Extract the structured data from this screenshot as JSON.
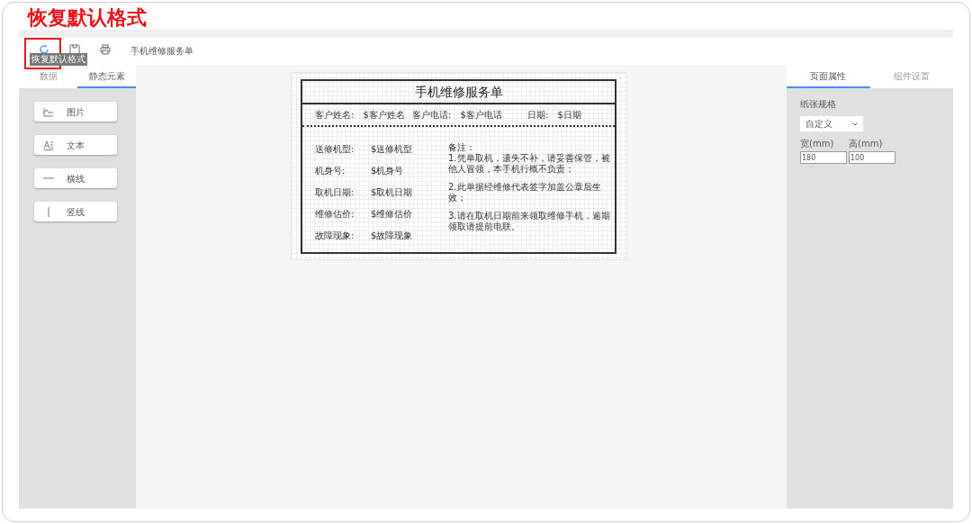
{
  "annotation": {
    "title": "恢复默认格式"
  },
  "toolbar": {
    "buttons": [
      {
        "kind": "reset"
      },
      {
        "kind": "save"
      },
      {
        "kind": "print"
      }
    ],
    "document_name": "手机维修服务单",
    "tooltip": "恢复默认格式"
  },
  "left_panel": {
    "tabs": [
      {
        "label": "数据",
        "selected": false
      },
      {
        "label": "静态元素",
        "selected": true
      }
    ],
    "items": [
      {
        "kind": "image",
        "label": "图片"
      },
      {
        "kind": "text",
        "label": "文本"
      },
      {
        "kind": "hline",
        "label": "横线"
      },
      {
        "kind": "vline",
        "label": "竖线"
      }
    ]
  },
  "form": {
    "title": "手机维修服务单",
    "header": [
      {
        "label": "客户姓名:",
        "value": "$客户姓名"
      },
      {
        "label": "客户电话:",
        "value": "$客户电话"
      },
      {
        "label": "日期:",
        "value": "$日期"
      }
    ],
    "fields": [
      {
        "label": "送修机型:",
        "value": "$送修机型"
      },
      {
        "label": "机身号:",
        "value": "$机身号"
      },
      {
        "label": "取机日期:",
        "value": "$取机日期"
      },
      {
        "label": "维修估价:",
        "value": "$维修估价"
      },
      {
        "label": "故障现象:",
        "value": "$故障现象"
      }
    ],
    "notes_title": "备注：",
    "notes": [
      "1.凭单取机，遗失不补，请妥善保管，被他人冒领，本手机行概不负责；",
      "2.此单据经维修代表签字加盖公章后生效；",
      "3.请在取机日期前来领取维修手机，逾期领取请提前电联。"
    ]
  },
  "right_panel": {
    "tabs": [
      {
        "label": "页面属性",
        "selected": true
      },
      {
        "label": "组件设置",
        "selected": false
      }
    ],
    "paper_label": "纸张规格",
    "paper_value": "自定义",
    "width_label": "宽(mm)",
    "width_value": "180",
    "height_label": "高(mm)",
    "height_value": "100"
  }
}
